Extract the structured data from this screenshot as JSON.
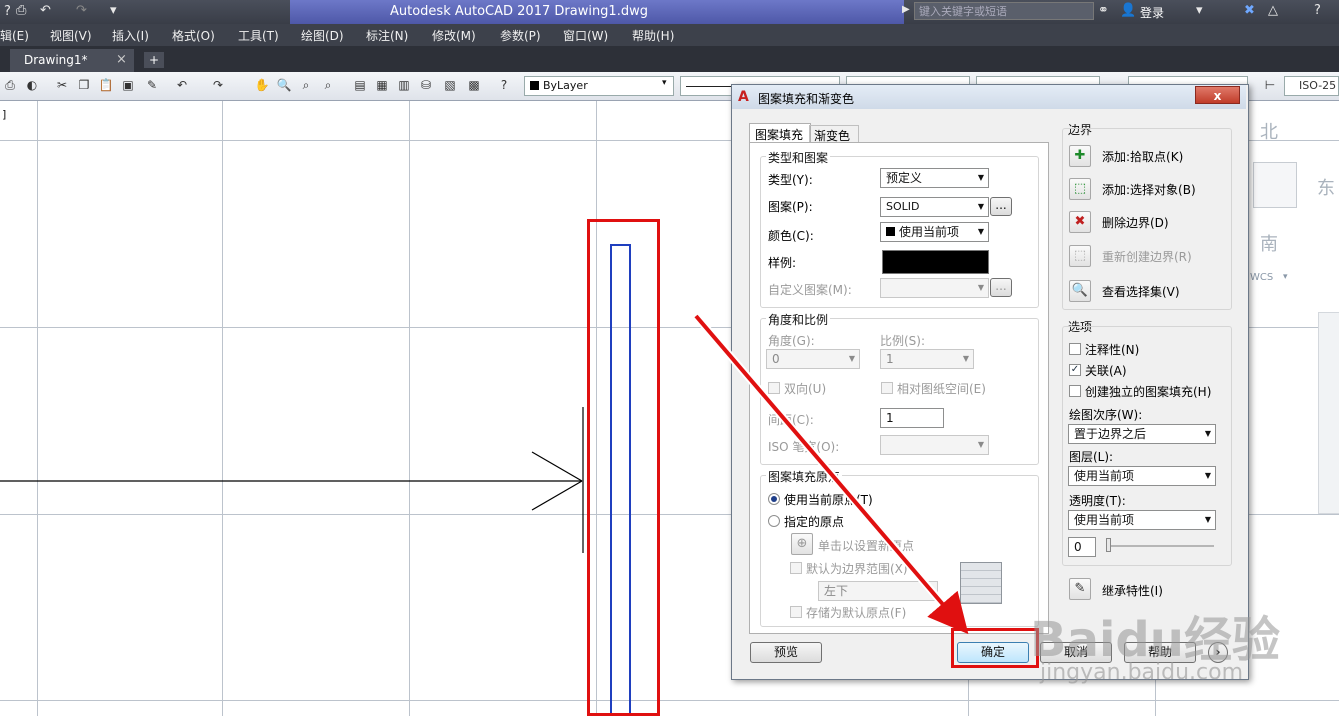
{
  "window": {
    "title": "Autodesk AutoCAD 2017    Drawing1.dwg",
    "search_placeholder": "键入关键字或短语",
    "login": "登录"
  },
  "menubar": [
    "辑(E)",
    "视图(V)",
    "插入(I)",
    "格式(O)",
    "工具(T)",
    "绘图(D)",
    "标注(N)",
    "修改(M)",
    "参数(P)",
    "窗口(W)",
    "帮助(H)"
  ],
  "tabs": {
    "active": "Drawing1*",
    "close": "×",
    "add": "+"
  },
  "toolbar": {
    "bylayer": "ByLayer",
    "iso25": "ISO-25"
  },
  "viewcube": {
    "north": "北",
    "east": "东",
    "south": "南",
    "wcs": "WCS"
  },
  "canvas": {
    "corner_text": "]"
  },
  "dialog": {
    "title": "图案填充和渐变色",
    "close": "x",
    "tabs": [
      "图案填充",
      "渐变色"
    ],
    "type_pattern": {
      "title": "类型和图案",
      "type_label": "类型(Y):",
      "type_value": "预定义",
      "pattern_label": "图案(P):",
      "pattern_value": "SOLID",
      "color_label": "颜色(C):",
      "color_value": "使用当前项",
      "swatch_label": "样例:",
      "custom_label": "自定义图案(M):",
      "browse": "..."
    },
    "angle_scale": {
      "title": "角度和比例",
      "angle_label": "角度(G):",
      "angle_value": "0",
      "scale_label": "比例(S):",
      "scale_value": "1",
      "double_label": "双向(U)",
      "relative_label": "相对图纸空间(E)",
      "spacing_label": "间距(C):",
      "spacing_value": "1",
      "iso_pen_label": "ISO 笔宽(O):"
    },
    "origin": {
      "title": "图案填充原点",
      "use_current": "使用当前原点(T)",
      "specified": "指定的原点",
      "click_set": "单击以设置新原点",
      "default_extent": "默认为边界范围(X)",
      "position": "左下",
      "store_default": "存储为默认原点(F)"
    },
    "boundary": {
      "title": "边界",
      "add_pick": "添加:拾取点(K)",
      "add_select": "添加:选择对象(B)",
      "remove": "删除边界(D)",
      "recreate": "重新创建边界(R)",
      "view_selection": "查看选择集(V)"
    },
    "options": {
      "title": "选项",
      "annotative": "注释性(N)",
      "associative": "关联(A)",
      "separate": "创建独立的图案填充(H)",
      "draw_order_label": "绘图次序(W):",
      "draw_order_value": "置于边界之后",
      "layer_label": "图层(L):",
      "layer_value": "使用当前项",
      "transparency_label": "透明度(T):",
      "transparency_value": "使用当前项",
      "transparency_level": "0"
    },
    "inherit": "继承特性(I)",
    "buttons": {
      "preview": "预览",
      "ok": "确定",
      "cancel": "取消",
      "help": "帮助",
      "more": "›"
    }
  },
  "watermark": {
    "brand": "Baidu经验",
    "url": "jingyan.baidu.com"
  },
  "colors": {
    "accent_red": "#e01010",
    "shape_blue": "#1f3fbf"
  }
}
